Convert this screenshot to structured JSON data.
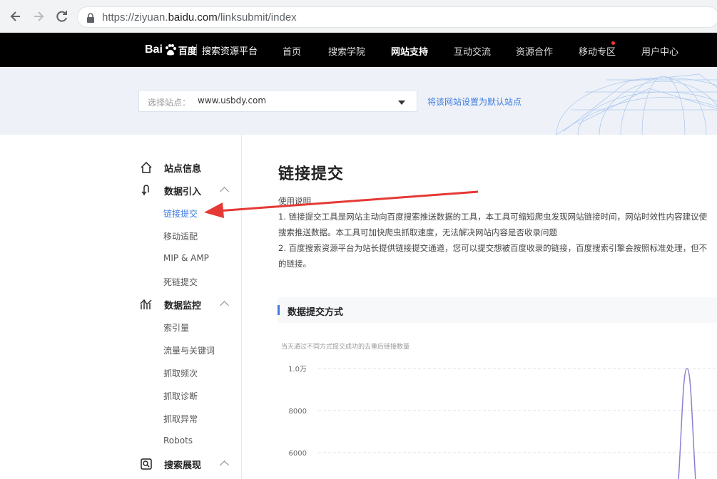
{
  "browser": {
    "url_prefix": "https://ziyuan.",
    "url_host": "baidu.com",
    "url_path": "/linksubmit/index"
  },
  "topnav": {
    "logo_text": "Bai",
    "logo_cn": "百度",
    "platform_title": "搜索资源平台",
    "items": [
      {
        "label": "首页"
      },
      {
        "label": "搜索学院"
      },
      {
        "label": "网站支持",
        "active": true
      },
      {
        "label": "互动交流"
      },
      {
        "label": "资源合作"
      },
      {
        "label": "移动专区",
        "badge": true
      },
      {
        "label": "用户中心"
      }
    ]
  },
  "site_selector": {
    "label": "选择站点：",
    "value": "www.usbdy.com",
    "set_default_link": "将该网站设置为默认站点"
  },
  "sidebar": {
    "sections": [
      {
        "label": "站点信息",
        "icon": "home-icon"
      },
      {
        "label": "数据引入",
        "icon": "data-import-icon",
        "items": [
          "链接提交",
          "移动适配",
          "MIP & AMP",
          "死链提交"
        ]
      },
      {
        "label": "数据监控",
        "icon": "monitor-icon",
        "items": [
          "索引量",
          "流量与关键词",
          "抓取频次",
          "抓取诊断",
          "抓取异常",
          "Robots"
        ]
      },
      {
        "label": "搜索展现",
        "icon": "search-display-icon"
      }
    ],
    "active_item": "链接提交"
  },
  "main": {
    "title": "链接提交",
    "usage_heading": "使用说明",
    "usage_lines": [
      "1. 链接提交工具是网站主动向百度搜索推送数据的工具，本工具可缩短爬虫发现网站链接时间，网站时效性内容建议使",
      "搜索推送数据。本工具可加快爬虫抓取速度，无法解决网站内容是否收录问题",
      "2. 百度搜索资源平台为站长提供链接提交通道，您可以提交想被百度收录的链接，百度搜索引擎会按照标准处理，但不",
      "的链接。"
    ],
    "panel_title": "数据提交方式",
    "chart_caption": "当天通过不同方式提交成功的去重后链接数量"
  },
  "chart_data": {
    "type": "line",
    "y_tick_labels": [
      "1.0万",
      "8000",
      "6000"
    ],
    "y_ticks": [
      10000,
      8000,
      6000
    ],
    "series": [
      {
        "color": "#8a80d0",
        "points": [
          {
            "x": 0,
            "y": 0
          },
          {
            "x": 1,
            "y": 10000
          },
          {
            "x": 2,
            "y": 0
          }
        ]
      }
    ],
    "grid": true
  },
  "colors": {
    "accent": "#3f7be0",
    "arrow": "#e53935",
    "nav_bg": "#000000"
  }
}
